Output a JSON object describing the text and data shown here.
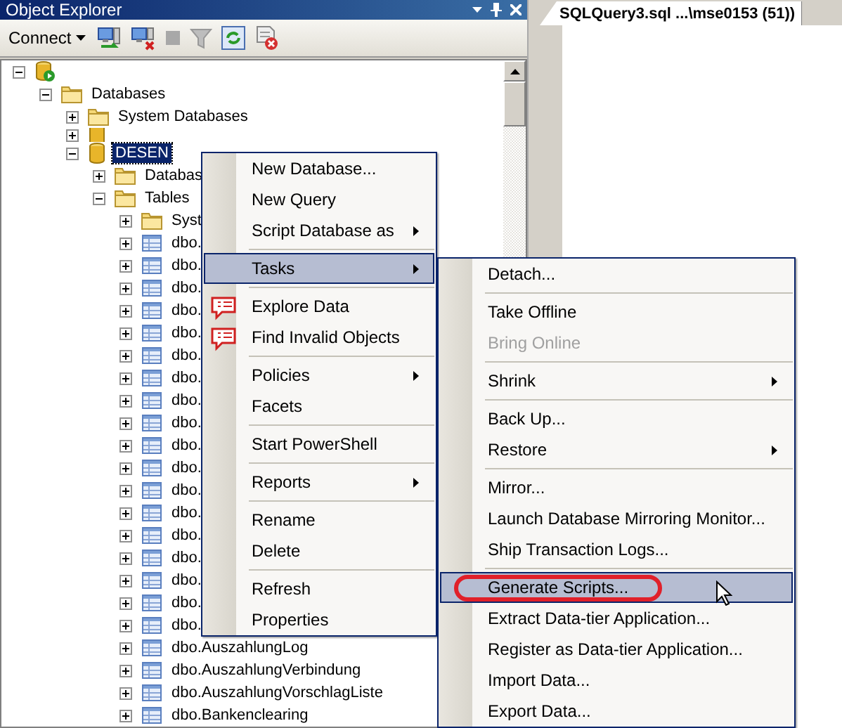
{
  "object_explorer": {
    "title": "Object Explorer",
    "connect_button": "Connect",
    "tree": [
      {
        "kind": "server",
        "expanded": true,
        "children": [
          {
            "kind": "folder",
            "label": "Databases",
            "expanded": true,
            "children": [
              {
                "kind": "folder",
                "label": "System Databases",
                "expanded": false
              },
              {
                "kind": "database",
                "expanded": false
              },
              {
                "kind": "database",
                "label": "DESEN",
                "selected": true,
                "expanded": true,
                "children": [
                  {
                    "kind": "folder",
                    "label": "Databas",
                    "expanded": false
                  },
                  {
                    "kind": "folder",
                    "label": "Tables",
                    "expanded": true,
                    "children": [
                      {
                        "kind": "folder",
                        "label": "Syst",
                        "expanded": false
                      },
                      {
                        "kind": "table",
                        "label": "dbo.",
                        "expanded": false
                      },
                      {
                        "kind": "table",
                        "label": "dbo.",
                        "expanded": false
                      },
                      {
                        "kind": "table",
                        "label": "dbo.",
                        "expanded": false
                      },
                      {
                        "kind": "table",
                        "label": "dbo.",
                        "expanded": false
                      },
                      {
                        "kind": "table",
                        "label": "dbo.",
                        "expanded": false
                      },
                      {
                        "kind": "table",
                        "label": "dbo.",
                        "expanded": false
                      },
                      {
                        "kind": "table",
                        "label": "dbo.",
                        "expanded": false
                      },
                      {
                        "kind": "table",
                        "label": "dbo.",
                        "expanded": false
                      },
                      {
                        "kind": "table",
                        "label": "dbo.",
                        "expanded": false
                      },
                      {
                        "kind": "table",
                        "label": "dbo.",
                        "expanded": false
                      },
                      {
                        "kind": "table",
                        "label": "dbo.",
                        "expanded": false
                      },
                      {
                        "kind": "table",
                        "label": "dbo.",
                        "expanded": false
                      },
                      {
                        "kind": "table",
                        "label": "dbo.",
                        "expanded": false
                      },
                      {
                        "kind": "table",
                        "label": "dbo.",
                        "expanded": false
                      },
                      {
                        "kind": "table",
                        "label": "dbo.",
                        "expanded": false
                      },
                      {
                        "kind": "table",
                        "label": "dbo.",
                        "expanded": false
                      },
                      {
                        "kind": "table",
                        "label": "dbo.",
                        "expanded": false
                      },
                      {
                        "kind": "table",
                        "label": "dbo.",
                        "expanded": false
                      },
                      {
                        "kind": "table",
                        "label": "dbo.AuszahlungLog",
                        "expanded": false
                      },
                      {
                        "kind": "table",
                        "label": "dbo.AuszahlungVerbindung",
                        "expanded": false
                      },
                      {
                        "kind": "table",
                        "label": "dbo.AuszahlungVorschlagListe",
                        "expanded": false
                      },
                      {
                        "kind": "table",
                        "label": "dbo.Bankenclearing",
                        "expanded": false
                      }
                    ]
                  }
                ]
              }
            ]
          }
        ]
      }
    ]
  },
  "document_tab": {
    "label": "SQLQuery3.sql ...\\mse0153 (51))",
    "selected": true
  },
  "context_menu": [
    {
      "kind": "item",
      "label": "New Database..."
    },
    {
      "kind": "item",
      "label": "New Query"
    },
    {
      "kind": "item",
      "label": "Script Database as",
      "submenu": true
    },
    {
      "kind": "separator"
    },
    {
      "kind": "item",
      "label": "Tasks",
      "submenu": true,
      "selected": true
    },
    {
      "kind": "separator"
    },
    {
      "kind": "item",
      "label": "Explore Data",
      "icon": true
    },
    {
      "kind": "item",
      "label": "Find Invalid Objects",
      "icon": true
    },
    {
      "kind": "separator"
    },
    {
      "kind": "item",
      "label": "Policies",
      "submenu": true
    },
    {
      "kind": "item",
      "label": "Facets"
    },
    {
      "kind": "separator"
    },
    {
      "kind": "item",
      "label": "Start PowerShell"
    },
    {
      "kind": "separator"
    },
    {
      "kind": "item",
      "label": "Reports",
      "submenu": true
    },
    {
      "kind": "separator"
    },
    {
      "kind": "item",
      "label": "Rename"
    },
    {
      "kind": "item",
      "label": "Delete"
    },
    {
      "kind": "separator"
    },
    {
      "kind": "item",
      "label": "Refresh"
    },
    {
      "kind": "item",
      "label": "Properties"
    }
  ],
  "tasks_submenu": [
    {
      "kind": "item",
      "label": "Detach..."
    },
    {
      "kind": "separator"
    },
    {
      "kind": "item",
      "label": "Take Offline"
    },
    {
      "kind": "item",
      "label": "Bring Online",
      "disabled": true
    },
    {
      "kind": "separator"
    },
    {
      "kind": "item",
      "label": "Shrink",
      "submenu": true
    },
    {
      "kind": "separator"
    },
    {
      "kind": "item",
      "label": "Back Up..."
    },
    {
      "kind": "item",
      "label": "Restore",
      "submenu": true
    },
    {
      "kind": "separator"
    },
    {
      "kind": "item",
      "label": "Mirror..."
    },
    {
      "kind": "item",
      "label": "Launch Database Mirroring Monitor..."
    },
    {
      "kind": "item",
      "label": "Ship Transaction Logs..."
    },
    {
      "kind": "separator"
    },
    {
      "kind": "item",
      "label": "Generate Scripts...",
      "selected": true,
      "highlighted": true
    },
    {
      "kind": "item",
      "label": "Extract Data-tier Application..."
    },
    {
      "kind": "item",
      "label": "Register as Data-tier Application..."
    },
    {
      "kind": "item",
      "label": "Import Data..."
    },
    {
      "kind": "item",
      "label": "Export Data..."
    }
  ]
}
